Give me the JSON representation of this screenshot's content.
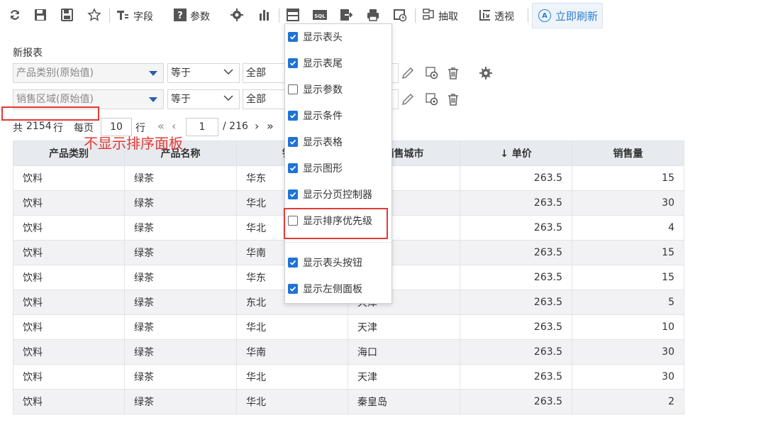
{
  "toolbar": {
    "field_label": "字段",
    "param_label": "参数",
    "extract_label": "抽取",
    "pivot_label": "透视",
    "refresh_label": "立即刷新"
  },
  "report": {
    "title": "新报表"
  },
  "conditions": [
    {
      "field": "产品类别(原始值)",
      "operator": "等于",
      "value": "全部"
    },
    {
      "field": "销售区域(原始值)",
      "operator": "等于",
      "value": "全部"
    }
  ],
  "pager": {
    "total_prefix": "共",
    "total": "2154",
    "rows_unit": "行",
    "per_page_label": "每页",
    "per_page": "10",
    "per_page_unit": "行",
    "current_page": "1",
    "total_pages": "/ 216"
  },
  "annotation": {
    "text": "不显示排序面板"
  },
  "table": {
    "headers": [
      "产品类别",
      "产品名称",
      "销售",
      "销售城市",
      "单价",
      "销售量"
    ],
    "sort_arrow": "↓",
    "rows": [
      [
        "饮料",
        "绿茶",
        "华东",
        "",
        "263.5",
        "15"
      ],
      [
        "饮料",
        "绿茶",
        "华北",
        "",
        "263.5",
        "30"
      ],
      [
        "饮料",
        "绿茶",
        "华北",
        "",
        "263.5",
        "4"
      ],
      [
        "饮料",
        "绿茶",
        "华南",
        "",
        "263.5",
        "15"
      ],
      [
        "饮料",
        "绿茶",
        "华东",
        "",
        "263.5",
        "15"
      ],
      [
        "饮料",
        "绿茶",
        "东北",
        "天津",
        "263.5",
        "5"
      ],
      [
        "饮料",
        "绿茶",
        "华北",
        "天津",
        "263.5",
        "10"
      ],
      [
        "饮料",
        "绿茶",
        "华南",
        "海口",
        "263.5",
        "30"
      ],
      [
        "饮料",
        "绿茶",
        "华北",
        "天津",
        "263.5",
        "30"
      ],
      [
        "饮料",
        "绿茶",
        "华北",
        "秦皇岛",
        "263.5",
        "2"
      ]
    ]
  },
  "menu": {
    "items": [
      {
        "label": "显示表头",
        "checked": true
      },
      {
        "label": "显示表尾",
        "checked": true
      },
      {
        "label": "显示参数",
        "checked": false
      },
      {
        "label": "显示条件",
        "checked": true
      },
      {
        "label": "显示表格",
        "checked": true
      },
      {
        "label": "显示图形",
        "checked": true
      },
      {
        "label": "显示分页控制器",
        "checked": true
      },
      {
        "label": "显示排序优先级",
        "checked": false
      },
      {
        "label": "显示表头按钮",
        "checked": true
      },
      {
        "label": "显示左侧面板",
        "checked": true
      }
    ]
  },
  "colors": {
    "accent": "#1e73d6",
    "annotation": "#e53935",
    "header_bg": "#e7ebef"
  }
}
